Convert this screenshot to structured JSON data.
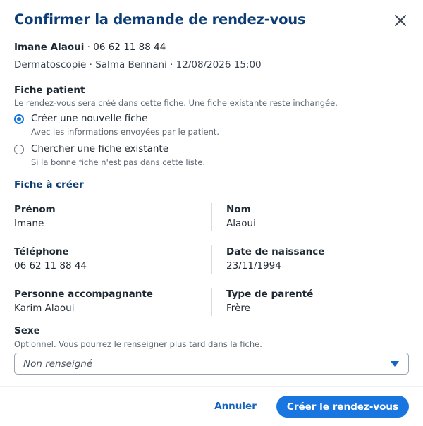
{
  "dialog": {
    "title": "Confirmer la demande de rendez-vous",
    "close_icon": "close-icon"
  },
  "summary": {
    "patient_name": "Imane Alaoui",
    "patient_phone": " · 06 62 11 88 44",
    "appointment": "Dermatoscopie · Salma Bennani · 12/08/2026 15:00"
  },
  "fiche_patient": {
    "label": "Fiche patient",
    "help": "Le rendez-vous sera créé dans cette fiche. Une fiche existante reste inchangée.",
    "options": [
      {
        "label": "Créer une nouvelle fiche",
        "description": "Avec les informations envoyées par le patient.",
        "checked": true
      },
      {
        "label": "Chercher une fiche existante",
        "description": "Si la bonne fiche n'est pas dans cette liste.",
        "checked": false
      }
    ]
  },
  "fiche_a_creer": {
    "heading": "Fiche à créer",
    "fields": {
      "prenom": {
        "label": "Prénom",
        "value": "Imane"
      },
      "nom": {
        "label": "Nom",
        "value": "Alaoui"
      },
      "telephone": {
        "label": "Téléphone",
        "value": "06 62 11 88 44"
      },
      "date_naissance": {
        "label": "Date de naissance",
        "value": "23/11/1994"
      },
      "accompagnant": {
        "label": "Personne accompagnante",
        "value": "Karim Alaoui"
      },
      "parente": {
        "label": "Type de parenté",
        "value": "Frère"
      }
    }
  },
  "sexe": {
    "label": "Sexe",
    "help": "Optionnel. Vous pourrez le renseigner plus tard dans la fiche.",
    "selected": "Non renseigné",
    "caret_icon": "caret-down-icon"
  },
  "footer": {
    "cancel_label": "Annuler",
    "submit_label": "Créer le rendez-vous"
  },
  "colors": {
    "title": "#0d3d75",
    "primary": "#1976e0",
    "link": "#1565c0"
  }
}
